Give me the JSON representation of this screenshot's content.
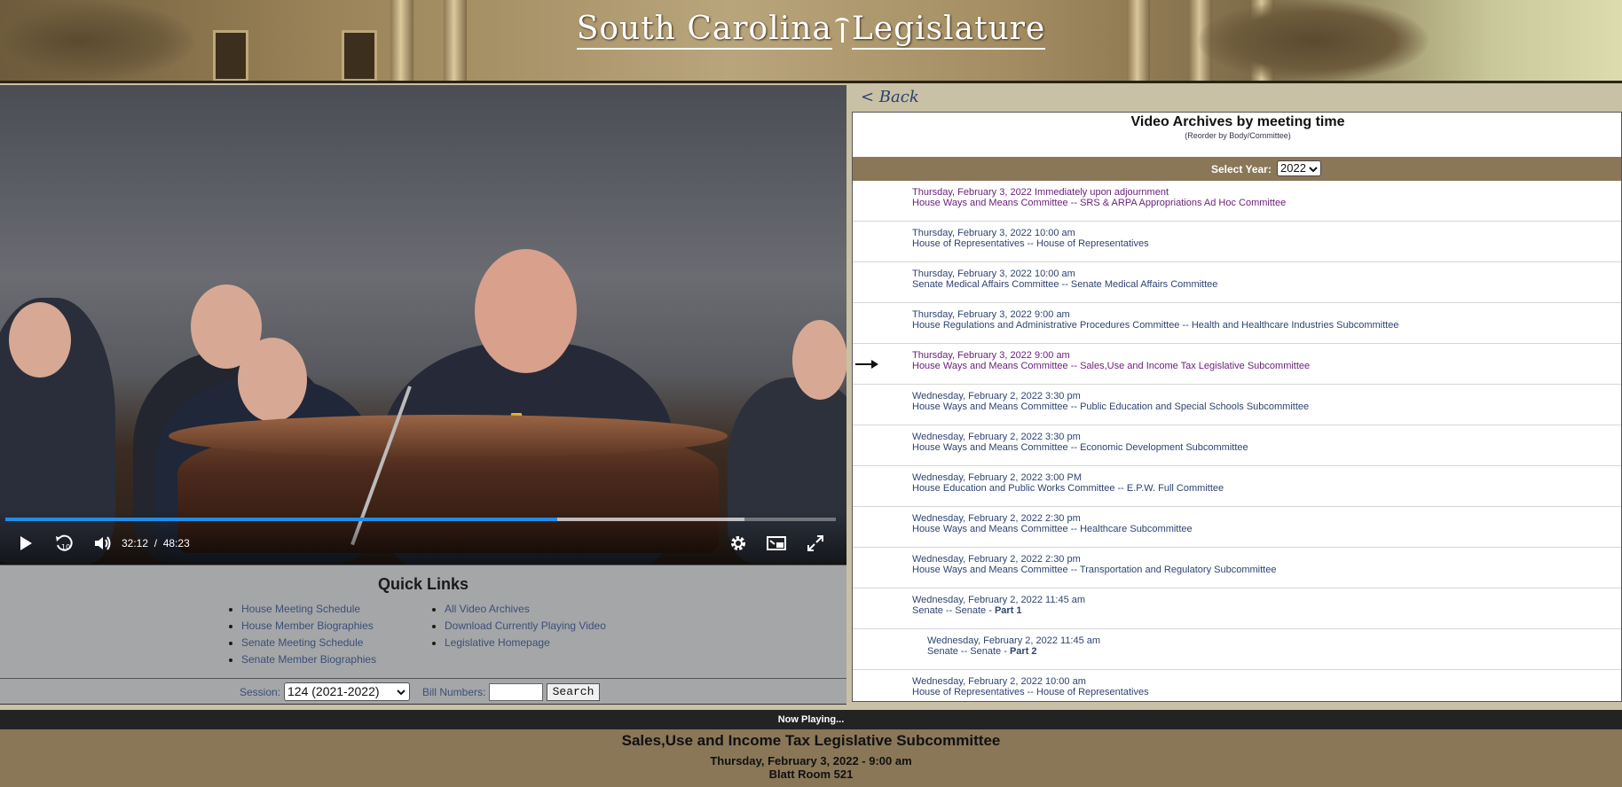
{
  "header": {
    "title_part1": "South Carolina",
    "title_part2": "Legislature"
  },
  "video": {
    "time_current": "32:12",
    "time_separator": "/",
    "time_total": "48:23",
    "progress_fraction": 0.665,
    "buffered_fraction": 0.89
  },
  "quick_links": {
    "title": "Quick Links",
    "left": [
      "House Meeting Schedule",
      "House Member Biographies",
      "Senate Meeting Schedule",
      "Senate Member Biographies"
    ],
    "right": [
      "All Video Archives",
      "Download Currently Playing Video",
      "Legislative Homepage"
    ]
  },
  "search": {
    "session_label": "Session:",
    "session_value": "124 (2021-2022)",
    "bill_label": "Bill Numbers:",
    "bill_value": "",
    "button_label": "Search"
  },
  "archive": {
    "back_label": "< Back",
    "title": "Video Archives by meeting time",
    "reorder_label": "(Reorder by Body/Committee)",
    "year_label": "Select Year:",
    "year_value": "2022",
    "rows": [
      {
        "line1": "Thursday, February 3, 2022  Immediately upon adjournment",
        "line2": "House Ways and Means Committee -- SRS & ARPA Appropriations Ad Hoc Committee",
        "line2_bold": "",
        "visited": true,
        "playing": false,
        "indent": false
      },
      {
        "line1": "Thursday, February 3, 2022  10:00 am",
        "line2": "House of Representatives -- House of Representatives",
        "line2_bold": "",
        "visited": false,
        "playing": false,
        "indent": false
      },
      {
        "line1": "Thursday, February 3, 2022  10:00 am",
        "line2": "Senate Medical Affairs Committee -- Senate Medical Affairs Committee",
        "line2_bold": "",
        "visited": false,
        "playing": false,
        "indent": false
      },
      {
        "line1": "Thursday, February 3, 2022  9:00 am",
        "line2": "House Regulations and Administrative Procedures Committee -- Health and Healthcare Industries Subcommittee",
        "line2_bold": "",
        "visited": false,
        "playing": false,
        "indent": false
      },
      {
        "line1": "Thursday, February 3, 2022  9:00 am",
        "line2": "House Ways and Means Committee -- Sales,Use and Income Tax Legislative Subcommittee",
        "line2_bold": "",
        "visited": true,
        "playing": true,
        "indent": false
      },
      {
        "line1": "Wednesday, February 2, 2022  3:30 pm",
        "line2": "House Ways and Means Committee -- Public Education and Special Schools Subcommittee",
        "line2_bold": "",
        "visited": false,
        "playing": false,
        "indent": false
      },
      {
        "line1": "Wednesday, February 2, 2022  3:30 pm",
        "line2": "House Ways and Means Committee -- Economic Development Subcommittee",
        "line2_bold": "",
        "visited": false,
        "playing": false,
        "indent": false
      },
      {
        "line1": "Wednesday, February 2, 2022  3:00 PM",
        "line2": "House Education and Public Works Committee -- E.P.W. Full Committee",
        "line2_bold": "",
        "visited": false,
        "playing": false,
        "indent": false
      },
      {
        "line1": "Wednesday, February 2, 2022  2:30 pm",
        "line2": "House Ways and Means Committee -- Healthcare Subcommittee",
        "line2_bold": "",
        "visited": false,
        "playing": false,
        "indent": false
      },
      {
        "line1": "Wednesday, February 2, 2022  2:30 pm",
        "line2": "House Ways and Means Committee -- Transportation and Regulatory Subcommittee",
        "line2_bold": "",
        "visited": false,
        "playing": false,
        "indent": false
      },
      {
        "line1": "Wednesday, February 2, 2022  11:45 am",
        "line2": "Senate -- Senate - ",
        "line2_bold": "Part 1",
        "visited": false,
        "playing": false,
        "indent": false
      },
      {
        "line1": "Wednesday, February 2, 2022  11:45 am",
        "line2": "Senate -- Senate - ",
        "line2_bold": "Part 2",
        "visited": false,
        "playing": false,
        "indent": true
      },
      {
        "line1": "Wednesday, February 2, 2022  10:00 am",
        "line2": "House of Representatives -- House of Representatives",
        "line2_bold": "",
        "visited": false,
        "playing": false,
        "indent": false
      }
    ]
  },
  "now_playing": {
    "label": "Now Playing...",
    "title": "Sales,Use and Income Tax Legislative Subcommittee",
    "datetime": "Thursday, February 3, 2022 - 9:00 am",
    "location": "Blatt Room 521"
  },
  "colors": {
    "link": "#2f4371",
    "visited": "#6a1d7a",
    "accent_progress": "#1f8ee8",
    "footer": "#8a7758"
  }
}
